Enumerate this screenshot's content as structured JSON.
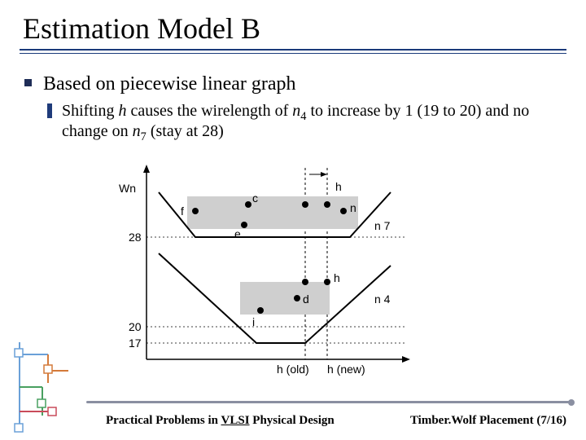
{
  "title": "Estimation Model B",
  "bullets": {
    "l1": "Based on piecewise linear graph",
    "l2_pre": "Shifting ",
    "l2_h": "h",
    "l2_a": " causes the wirelength of ",
    "l2_n4": "n",
    "l2_n4_sub": "4",
    "l2_b": " to increase by 1 (19 to 20) and no change on ",
    "l2_n7": "n",
    "l2_n7_sub": "7",
    "l2_c": " (stay at 28)"
  },
  "diagram": {
    "y_label": "Wn",
    "y_ticks": {
      "t28": "28",
      "t20": "20",
      "t17": "17"
    },
    "x_label_old": "h (old)",
    "x_label_new": "h (new)",
    "pts": {
      "f": "f",
      "c": "c",
      "e": "e",
      "n": "n",
      "h1": "h",
      "h2": "h",
      "d": "d",
      "i": "i"
    },
    "net_n7": "n 7",
    "net_n4": "n 4"
  },
  "footer": {
    "left_a": "Practical Problems in ",
    "left_b": "VLSI",
    "left_c": " Physical Design",
    "right": "Timber.Wolf Placement (7/16)"
  },
  "chart_data": {
    "type": "line",
    "title": "Piecewise linear wirelength vs horizontal position h",
    "ylabel": "Wn",
    "xlabel": "h",
    "x_markers": [
      "h (old)",
      "h (new)"
    ],
    "y_ticks": [
      17,
      20,
      28
    ],
    "series": [
      {
        "name": "n7",
        "kind": "piecewise-linear",
        "min_value": 28,
        "value_at_h_old": 28,
        "value_at_h_new": 28,
        "points_on_flat": [
          "f",
          "c",
          "e",
          "n",
          "h"
        ]
      },
      {
        "name": "n4",
        "kind": "piecewise-linear",
        "min_value": 17,
        "value_at_h_old": 19,
        "value_at_h_new": 20,
        "points_on_flat": [
          "i",
          "d",
          "h"
        ]
      }
    ],
    "annotations": [
      "Shifting h increases wirelength of n4 by 1 (19 to 20)",
      "Shifting h causes no change on n7 (stay at 28)"
    ]
  }
}
